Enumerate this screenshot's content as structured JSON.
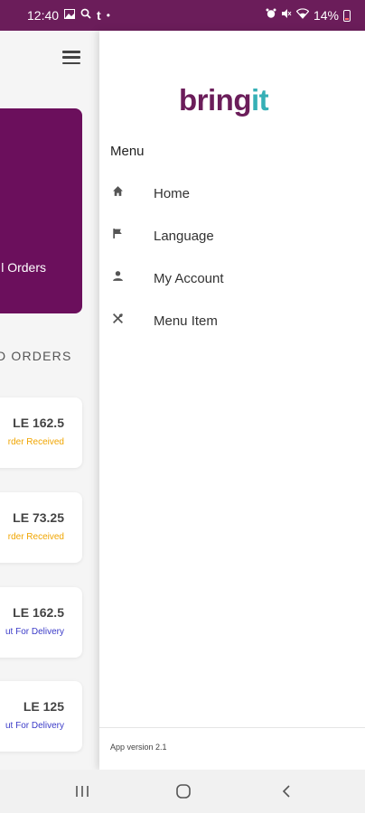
{
  "status_bar": {
    "time": "12:40",
    "battery": "14%",
    "left_icons": [
      "gallery-icon",
      "search-icon",
      "tumblr-icon",
      "dot-icon"
    ],
    "right_icons": [
      "alarm-icon",
      "mute-icon",
      "wifi-icon",
      "battery-icon"
    ]
  },
  "background": {
    "promo_label": "l Orders",
    "orders_heading": "D ORDERS",
    "orders": [
      {
        "price": "LE 162.5",
        "status": "rder Received",
        "status_color": "#f0a500"
      },
      {
        "price": "LE 73.25",
        "status": "rder Received",
        "status_color": "#f0a500"
      },
      {
        "price": "LE 162.5",
        "status": "ut For Delivery",
        "status_color": "#3b3bc8"
      },
      {
        "price": "LE 125",
        "status": "ut For Delivery",
        "status_color": "#3b3bc8"
      }
    ]
  },
  "drawer": {
    "logo_part1": "bring",
    "logo_part2": "it",
    "menu_title": "Menu",
    "items": [
      {
        "label": "Home",
        "icon": "home-icon"
      },
      {
        "label": "Language",
        "icon": "flag-icon"
      },
      {
        "label": "My Account",
        "icon": "person-icon"
      },
      {
        "label": "Menu Item",
        "icon": "utensils-icon"
      }
    ],
    "app_version": "App version 2.1"
  },
  "colors": {
    "brand_purple": "#6b1d5a",
    "brand_teal": "#36b0b6",
    "promo_bg": "#6b0f5c"
  }
}
